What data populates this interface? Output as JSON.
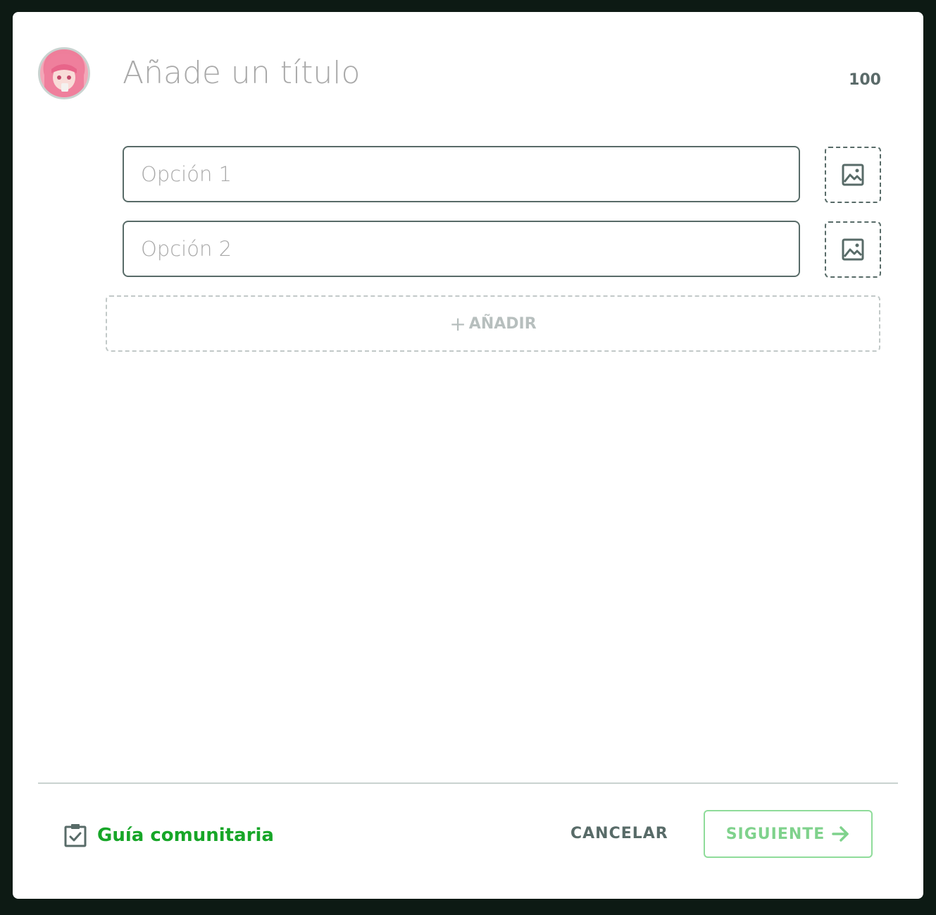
{
  "post": {
    "title_placeholder": "Añade un título",
    "char_count": "100",
    "options": [
      {
        "placeholder": "Opción 1"
      },
      {
        "placeholder": "Opción 2"
      }
    ],
    "add_label": "AÑADIR",
    "add_icon": "+"
  },
  "footer": {
    "guide_label": "Guía comunitaria",
    "cancel_label": "CANCELAR",
    "next_label": "SIGUIENTE"
  },
  "icons": {
    "avatar": "user-avatar",
    "image": "image-icon",
    "guide": "clipboard-check-icon",
    "next": "arrow-right-icon"
  },
  "colors": {
    "background": "#0d1a14",
    "border": "#586b68",
    "accent_green": "#17a628",
    "next_button": "#7fd28c"
  }
}
